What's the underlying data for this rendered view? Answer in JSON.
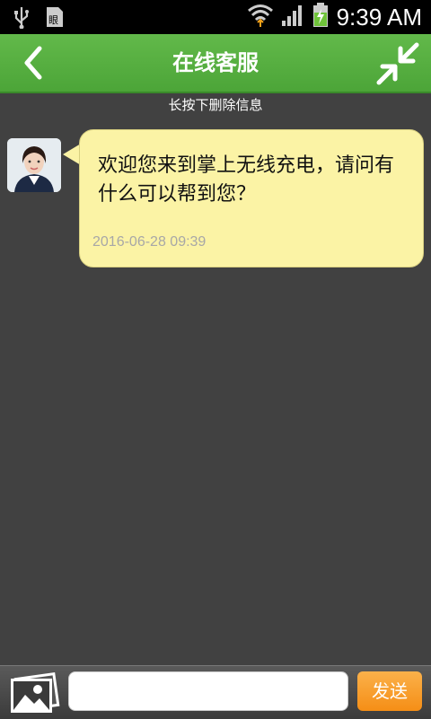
{
  "status_bar": {
    "time": "9:39 AM",
    "left_icons": [
      "usb-icon",
      "sim-card-icon"
    ],
    "right_icons": [
      "wifi-icon",
      "signal-icon",
      "battery-charging-icon"
    ]
  },
  "header": {
    "title": "在线客服",
    "back_icon": "chevron-left-icon",
    "collapse_icon": "collapse-arrows-icon",
    "bg_color": "#56ad3f"
  },
  "hint": "长按下删除信息",
  "messages": [
    {
      "avatar": "customer-service-avatar",
      "text": "欢迎您来到掌上无线充电，请问有什么可以帮到您？",
      "timestamp": "2016-06-28 09:39",
      "bubble_color": "#fbf3a5"
    }
  ],
  "composer": {
    "image_icon": "image-icon",
    "input_value": "",
    "send_label": "发送",
    "send_color": "#f7a030"
  }
}
